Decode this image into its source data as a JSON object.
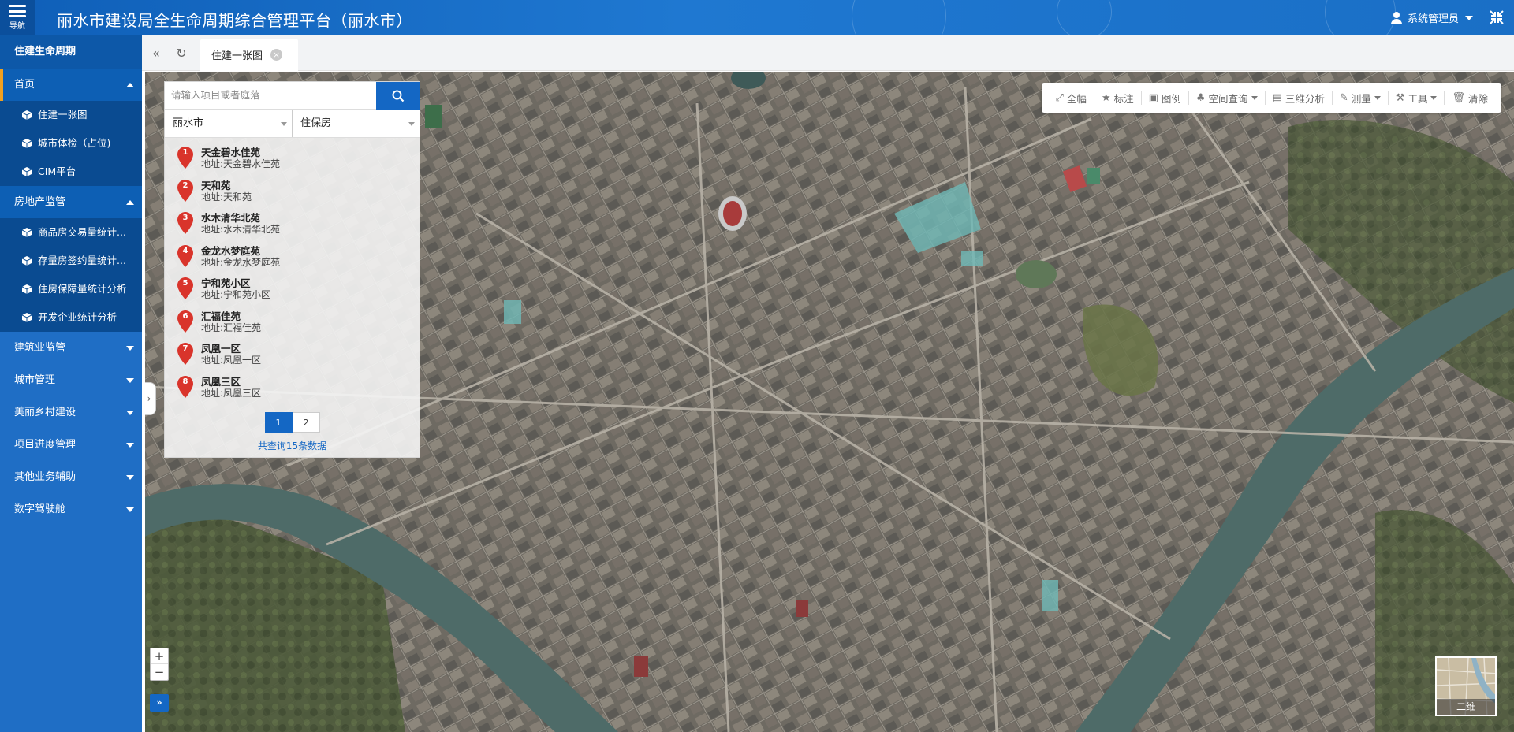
{
  "header": {
    "nav_label": "导航",
    "title": "丽水市建设局全生命周期综合管理平台（丽水市）",
    "user": "系统管理员"
  },
  "sidebar": {
    "top_label": "住建生命周期",
    "groups": [
      {
        "label": "首页",
        "expanded": true,
        "items": [
          "住建一张图",
          "城市体检（占位)",
          "CIM平台"
        ]
      },
      {
        "label": "房地产监管",
        "expanded": true,
        "items": [
          "商品房交易量统计...",
          "存量房签约量统计...",
          "住房保障量统计分析",
          "开发企业统计分析"
        ]
      },
      {
        "label": "建筑业监管",
        "expanded": false
      },
      {
        "label": "城市管理",
        "expanded": false
      },
      {
        "label": "美丽乡村建设",
        "expanded": false
      },
      {
        "label": "项目进度管理",
        "expanded": false
      },
      {
        "label": "其他业务辅助",
        "expanded": false
      },
      {
        "label": "数字驾驶舱",
        "expanded": false
      }
    ]
  },
  "tabs": {
    "active": "住建一张图"
  },
  "search": {
    "placeholder": "请输入项目或者庭落",
    "city": "丽水市",
    "category": "住保房",
    "results": [
      {
        "num": "1",
        "name": "天金碧水佳苑",
        "addr": "地址:天金碧水佳苑"
      },
      {
        "num": "2",
        "name": "天和苑",
        "addr": "地址:天和苑"
      },
      {
        "num": "3",
        "name": "水木清华北苑",
        "addr": "地址:水木清华北苑"
      },
      {
        "num": "4",
        "name": "金龙水梦庭苑",
        "addr": "地址:金龙水梦庭苑"
      },
      {
        "num": "5",
        "name": "宁和苑小区",
        "addr": "地址:宁和苑小区"
      },
      {
        "num": "6",
        "name": "汇福佳苑",
        "addr": "地址:汇福佳苑"
      },
      {
        "num": "7",
        "name": "凤凰一区",
        "addr": "地址:凤凰一区"
      },
      {
        "num": "8",
        "name": "凤凰三区",
        "addr": "地址:凤凰三区"
      }
    ],
    "pages": [
      "1",
      "2"
    ],
    "current_page": "1",
    "total": "共查询15条数据"
  },
  "toolbar": {
    "fullview": "全幅",
    "mark": "标注",
    "legend": "图例",
    "spatial_query": "空间查询",
    "analysis_3d": "三维分析",
    "measure": "测量",
    "tools": "工具",
    "clear": "清除"
  },
  "map": {
    "overview_label": "二维"
  },
  "colors": {
    "header": "#1a6fc6",
    "sidebar": "#1f6ec5",
    "sidebar_sub": "#0a4b91",
    "accent": "#1467c4",
    "active_marker": "#f0a020",
    "pin": "#d9342b"
  }
}
